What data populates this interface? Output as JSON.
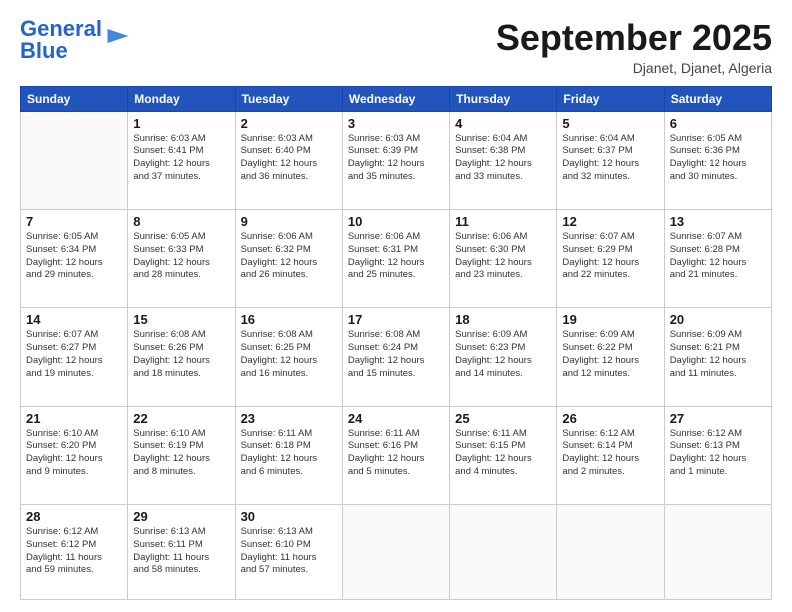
{
  "header": {
    "logo_line1": "General",
    "logo_line2": "Blue",
    "month": "September 2025",
    "location": "Djanet, Djanet, Algeria"
  },
  "weekdays": [
    "Sunday",
    "Monday",
    "Tuesday",
    "Wednesday",
    "Thursday",
    "Friday",
    "Saturday"
  ],
  "weeks": [
    [
      {
        "day": "",
        "info": ""
      },
      {
        "day": "1",
        "info": "Sunrise: 6:03 AM\nSunset: 6:41 PM\nDaylight: 12 hours\nand 37 minutes."
      },
      {
        "day": "2",
        "info": "Sunrise: 6:03 AM\nSunset: 6:40 PM\nDaylight: 12 hours\nand 36 minutes."
      },
      {
        "day": "3",
        "info": "Sunrise: 6:03 AM\nSunset: 6:39 PM\nDaylight: 12 hours\nand 35 minutes."
      },
      {
        "day": "4",
        "info": "Sunrise: 6:04 AM\nSunset: 6:38 PM\nDaylight: 12 hours\nand 33 minutes."
      },
      {
        "day": "5",
        "info": "Sunrise: 6:04 AM\nSunset: 6:37 PM\nDaylight: 12 hours\nand 32 minutes."
      },
      {
        "day": "6",
        "info": "Sunrise: 6:05 AM\nSunset: 6:36 PM\nDaylight: 12 hours\nand 30 minutes."
      }
    ],
    [
      {
        "day": "7",
        "info": "Sunrise: 6:05 AM\nSunset: 6:34 PM\nDaylight: 12 hours\nand 29 minutes."
      },
      {
        "day": "8",
        "info": "Sunrise: 6:05 AM\nSunset: 6:33 PM\nDaylight: 12 hours\nand 28 minutes."
      },
      {
        "day": "9",
        "info": "Sunrise: 6:06 AM\nSunset: 6:32 PM\nDaylight: 12 hours\nand 26 minutes."
      },
      {
        "day": "10",
        "info": "Sunrise: 6:06 AM\nSunset: 6:31 PM\nDaylight: 12 hours\nand 25 minutes."
      },
      {
        "day": "11",
        "info": "Sunrise: 6:06 AM\nSunset: 6:30 PM\nDaylight: 12 hours\nand 23 minutes."
      },
      {
        "day": "12",
        "info": "Sunrise: 6:07 AM\nSunset: 6:29 PM\nDaylight: 12 hours\nand 22 minutes."
      },
      {
        "day": "13",
        "info": "Sunrise: 6:07 AM\nSunset: 6:28 PM\nDaylight: 12 hours\nand 21 minutes."
      }
    ],
    [
      {
        "day": "14",
        "info": "Sunrise: 6:07 AM\nSunset: 6:27 PM\nDaylight: 12 hours\nand 19 minutes."
      },
      {
        "day": "15",
        "info": "Sunrise: 6:08 AM\nSunset: 6:26 PM\nDaylight: 12 hours\nand 18 minutes."
      },
      {
        "day": "16",
        "info": "Sunrise: 6:08 AM\nSunset: 6:25 PM\nDaylight: 12 hours\nand 16 minutes."
      },
      {
        "day": "17",
        "info": "Sunrise: 6:08 AM\nSunset: 6:24 PM\nDaylight: 12 hours\nand 15 minutes."
      },
      {
        "day": "18",
        "info": "Sunrise: 6:09 AM\nSunset: 6:23 PM\nDaylight: 12 hours\nand 14 minutes."
      },
      {
        "day": "19",
        "info": "Sunrise: 6:09 AM\nSunset: 6:22 PM\nDaylight: 12 hours\nand 12 minutes."
      },
      {
        "day": "20",
        "info": "Sunrise: 6:09 AM\nSunset: 6:21 PM\nDaylight: 12 hours\nand 11 minutes."
      }
    ],
    [
      {
        "day": "21",
        "info": "Sunrise: 6:10 AM\nSunset: 6:20 PM\nDaylight: 12 hours\nand 9 minutes."
      },
      {
        "day": "22",
        "info": "Sunrise: 6:10 AM\nSunset: 6:19 PM\nDaylight: 12 hours\nand 8 minutes."
      },
      {
        "day": "23",
        "info": "Sunrise: 6:11 AM\nSunset: 6:18 PM\nDaylight: 12 hours\nand 6 minutes."
      },
      {
        "day": "24",
        "info": "Sunrise: 6:11 AM\nSunset: 6:16 PM\nDaylight: 12 hours\nand 5 minutes."
      },
      {
        "day": "25",
        "info": "Sunrise: 6:11 AM\nSunset: 6:15 PM\nDaylight: 12 hours\nand 4 minutes."
      },
      {
        "day": "26",
        "info": "Sunrise: 6:12 AM\nSunset: 6:14 PM\nDaylight: 12 hours\nand 2 minutes."
      },
      {
        "day": "27",
        "info": "Sunrise: 6:12 AM\nSunset: 6:13 PM\nDaylight: 12 hours\nand 1 minute."
      }
    ],
    [
      {
        "day": "28",
        "info": "Sunrise: 6:12 AM\nSunset: 6:12 PM\nDaylight: 11 hours\nand 59 minutes."
      },
      {
        "day": "29",
        "info": "Sunrise: 6:13 AM\nSunset: 6:11 PM\nDaylight: 11 hours\nand 58 minutes."
      },
      {
        "day": "30",
        "info": "Sunrise: 6:13 AM\nSunset: 6:10 PM\nDaylight: 11 hours\nand 57 minutes."
      },
      {
        "day": "",
        "info": ""
      },
      {
        "day": "",
        "info": ""
      },
      {
        "day": "",
        "info": ""
      },
      {
        "day": "",
        "info": ""
      }
    ]
  ]
}
